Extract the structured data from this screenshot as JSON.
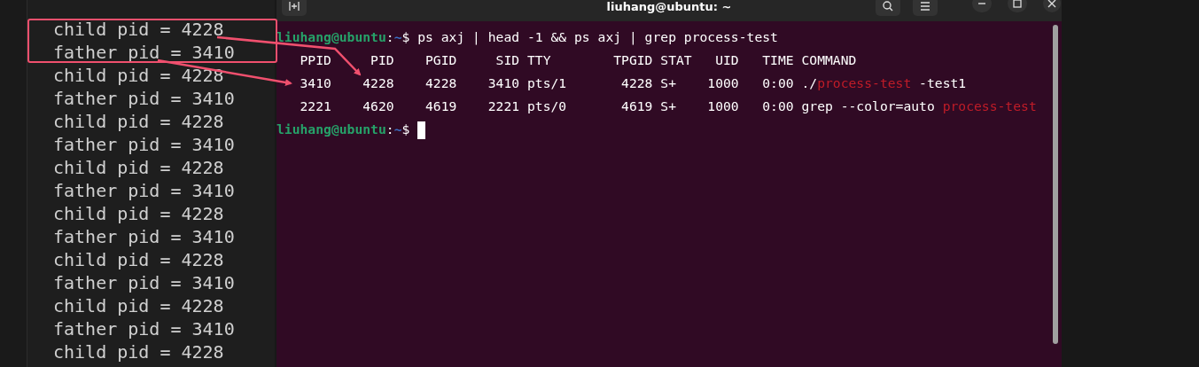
{
  "output_pane": {
    "lines": [
      "child pid = 4228",
      "father pid = 3410",
      "child pid = 4228",
      "father pid = 3410",
      "child pid = 4228",
      "father pid = 3410",
      "child pid = 4228",
      "father pid = 3410",
      "child pid = 4228",
      "father pid = 3410",
      "child pid = 4228",
      "father pid = 3410",
      "child pid = 4228",
      "father pid = 3410",
      "child pid = 4228"
    ]
  },
  "terminal": {
    "title": "liuhang@ubuntu: ~",
    "lines": [
      [
        {
          "kind": "user",
          "text": "liuhang@ubuntu"
        },
        {
          "kind": "plain",
          "text": ":"
        },
        {
          "kind": "path",
          "text": "~"
        },
        {
          "kind": "plain",
          "text": "$ ps axj | head -1 && ps axj | grep process-test"
        }
      ],
      [
        {
          "kind": "plain",
          "text": "   PPID     PID    PGID     SID TTY        TPGID STAT   UID   TIME COMMAND"
        }
      ],
      [
        {
          "kind": "plain",
          "text": "   3410    4228    4228    3410 pts/1       4228 S+    1000   0:00 ./"
        },
        {
          "kind": "match",
          "text": "process-test"
        },
        {
          "kind": "plain",
          "text": " -test1"
        }
      ],
      [
        {
          "kind": "plain",
          "text": "   2221    4620    4619    2221 pts/0       4619 S+    1000   0:00 grep --color=auto "
        },
        {
          "kind": "match",
          "text": "process-test"
        }
      ],
      [
        {
          "kind": "user",
          "text": "liuhang@ubuntu"
        },
        {
          "kind": "plain",
          "text": ":"
        },
        {
          "kind": "path",
          "text": "~"
        },
        {
          "kind": "plain",
          "text": "$ "
        },
        {
          "kind": "cursor"
        }
      ]
    ]
  }
}
